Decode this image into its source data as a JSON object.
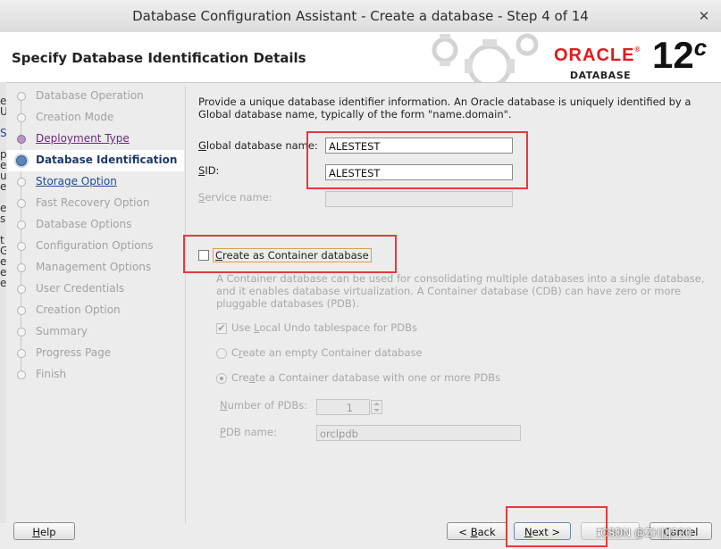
{
  "window": {
    "title": "Database Configuration Assistant - Create a database - Step 4 of 14",
    "close_glyph": "✕"
  },
  "header": {
    "heading": "Specify Database Identification Details",
    "brand": {
      "oracle": "ORACLE",
      "registered": "®",
      "database": "DATABASE",
      "version": "12",
      "version_suffix": "c",
      "color": "#e01b1b"
    }
  },
  "left_edge_chars": [
    "e",
    "U",
    "",
    "S",
    "",
    "p",
    "e",
    "u",
    "e",
    "",
    "e",
    "s",
    "",
    "t",
    "G",
    "e",
    "e",
    "e"
  ],
  "nav": {
    "items": [
      {
        "label": "Database Operation",
        "state": "disabled"
      },
      {
        "label": "Creation Mode",
        "state": "disabled"
      },
      {
        "label": "Deployment Type",
        "state": "visited"
      },
      {
        "label": "Database Identification",
        "state": "current"
      },
      {
        "label": "Storage Option",
        "state": "link"
      },
      {
        "label": "Fast Recovery Option",
        "state": "disabled"
      },
      {
        "label": "Database Options",
        "state": "disabled"
      },
      {
        "label": "Configuration Options",
        "state": "disabled"
      },
      {
        "label": "Management Options",
        "state": "disabled"
      },
      {
        "label": "User Credentials",
        "state": "disabled"
      },
      {
        "label": "Creation Option",
        "state": "disabled"
      },
      {
        "label": "Summary",
        "state": "disabled"
      },
      {
        "label": "Progress Page",
        "state": "disabled"
      },
      {
        "label": "Finish",
        "state": "disabled"
      }
    ]
  },
  "content": {
    "intro_line1": "Provide a unique database identifier information. An Oracle database is uniquely identified by a",
    "intro_line2": "Global database name, typically of the form \"name.domain\".",
    "global_db_name": {
      "label_mnemonic": "G",
      "label_rest": "lobal database name:",
      "value": "ALESTEST"
    },
    "sid": {
      "label_mnemonic": "S",
      "label_rest": "ID:",
      "value": "ALESTEST"
    },
    "service_name": {
      "label_mnemonic": "S",
      "label_rest": "ervice name:",
      "value": ""
    },
    "container_checkbox": {
      "label_mnemonic": "C",
      "label_rest": "reate as Container database",
      "checked": false
    },
    "container_desc": [
      "A Container database can be used for consolidating multiple databases into a single database,",
      "and it enables database virtualization. A Container database (CDB) can have zero or more",
      "pluggable databases (PDB)."
    ],
    "local_undo": {
      "label_pre": "Use ",
      "label_mnemonic": "L",
      "label_rest": "ocal Undo tablespace for PDBs",
      "checked": true,
      "check_glyph": "✔"
    },
    "empty_cdb": {
      "label_pre": "C",
      "label_mnemonic": "r",
      "label_rest": "eate an empty Container database"
    },
    "cdb_with_pdbs": {
      "label_pre": "Cre",
      "label_mnemonic": "a",
      "label_rest": "te a Container database with one or more PDBs"
    },
    "num_pdbs": {
      "label_mnemonic": "N",
      "label_rest": "umber of PDBs:",
      "value": "1"
    },
    "pdb_name": {
      "label_mnemonic": "P",
      "label_rest": "DB name:",
      "value": "orclpdb"
    }
  },
  "buttons": {
    "help": {
      "mnemonic": "H",
      "rest": "elp"
    },
    "back": {
      "pre": "< ",
      "mnemonic": "B",
      "rest": "ack"
    },
    "next": {
      "mnemonic": "N",
      "rest": "ext >"
    },
    "finish": {
      "mnemonic": "F",
      "rest": "inish"
    },
    "cancel": "Cancel"
  },
  "watermark": "CSDN @ZH|||520",
  "annotation_color": "#e23b3b"
}
